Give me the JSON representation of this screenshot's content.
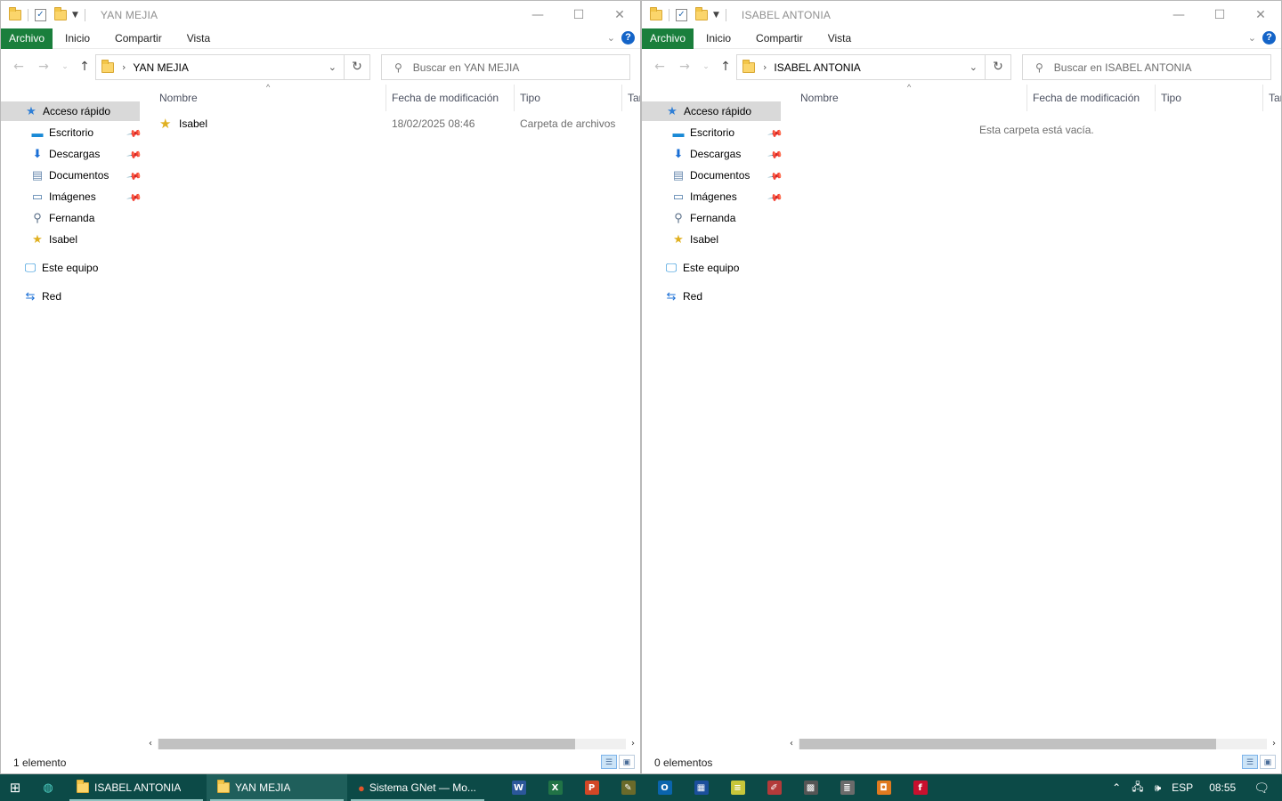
{
  "left_window": {
    "title": "YAN MEJIA",
    "ribbon": {
      "file": "Archivo",
      "home": "Inicio",
      "share": "Compartir",
      "view": "Vista"
    },
    "address": "YAN MEJIA",
    "search_placeholder": "Buscar en YAN MEJIA",
    "nav": {
      "quick_access": "Acceso rápido",
      "items": [
        "Escritorio",
        "Descargas",
        "Documentos",
        "Imágenes",
        "Fernanda",
        "Isabel"
      ],
      "this_pc": "Este equipo",
      "network": "Red"
    },
    "columns": {
      "name": "Nombre",
      "modified": "Fecha de modificación",
      "type": "Tipo",
      "size": "Tar"
    },
    "files": [
      {
        "name": "Isabel",
        "modified": "18/02/2025 08:46",
        "type": "Carpeta de archivos"
      }
    ],
    "status": "1 elemento"
  },
  "right_window": {
    "title": "ISABEL ANTONIA",
    "ribbon": {
      "file": "Archivo",
      "home": "Inicio",
      "share": "Compartir",
      "view": "Vista"
    },
    "address": "ISABEL ANTONIA",
    "search_placeholder": "Buscar en ISABEL ANTONIA",
    "nav": {
      "quick_access": "Acceso rápido",
      "items": [
        "Escritorio",
        "Descargas",
        "Documentos",
        "Imágenes",
        "Fernanda",
        "Isabel"
      ],
      "this_pc": "Este equipo",
      "network": "Red"
    },
    "columns": {
      "name": "Nombre",
      "modified": "Fecha de modificación",
      "type": "Tipo",
      "size": "Tar"
    },
    "empty_message": "Esta carpeta está vacía.",
    "status": "0 elementos"
  },
  "taskbar": {
    "apps": [
      "ISABEL ANTONIA",
      "YAN MEJIA",
      "Sistema GNet — Mo..."
    ],
    "pinned": [
      {
        "icon": "word-icon",
        "glyph": "W",
        "color": "#2b579a"
      },
      {
        "icon": "excel-icon",
        "glyph": "X",
        "color": "#217346"
      },
      {
        "icon": "powerpoint-icon",
        "glyph": "P",
        "color": "#d24726"
      },
      {
        "icon": "tool-icon",
        "glyph": "✎",
        "color": "#6a6a2a"
      },
      {
        "icon": "outlook-icon",
        "glyph": "O",
        "color": "#0a64ad"
      },
      {
        "icon": "app-icon",
        "glyph": "▦",
        "color": "#1b4f9c"
      },
      {
        "icon": "notes-icon",
        "glyph": "≡",
        "color": "#c7c63a"
      },
      {
        "icon": "pen-icon",
        "glyph": "✐",
        "color": "#b33a3a"
      },
      {
        "icon": "grid-icon",
        "glyph": "▩",
        "color": "#555555"
      },
      {
        "icon": "db-icon",
        "glyph": "≣",
        "color": "#6b6b6b"
      },
      {
        "icon": "orange-app-icon",
        "glyph": "◘",
        "color": "#e07a1f"
      },
      {
        "icon": "red-app-icon",
        "glyph": "f",
        "color": "#c8102e"
      }
    ],
    "tray": {
      "language": "ESP",
      "time": "08:55"
    }
  }
}
